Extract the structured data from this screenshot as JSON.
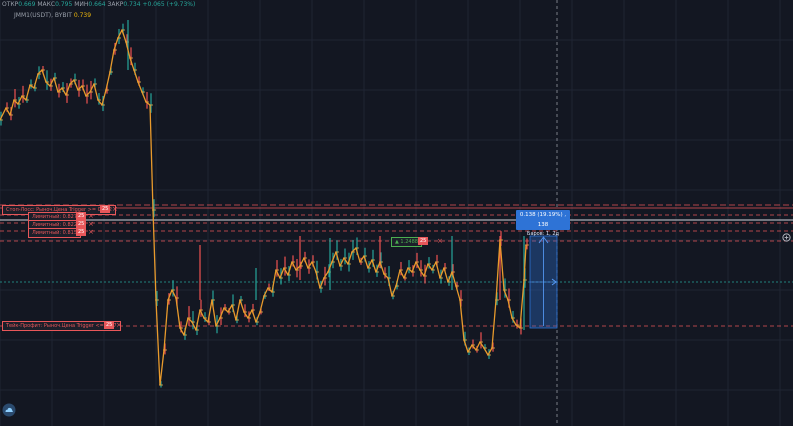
{
  "header": {
    "ohlc": [
      {
        "label": "ОТКР",
        "value": "0.669"
      },
      {
        "label": "МАКС",
        "value": "0.795"
      },
      {
        "label": "МИН",
        "value": "0.664"
      },
      {
        "label": "ЗАКР",
        "value": "0.734"
      }
    ],
    "change": "+0.065 (+9.73%)",
    "indicator_label": "JMM1(USDT), BYBIT",
    "indicator_value": "0.739"
  },
  "orders": {
    "stop_loss": {
      "label": "Стоп-Лосс: Рыноч.Цена Trigger >= 0.832",
      "count": "25",
      "close": "×"
    },
    "limit_1": {
      "label": "Лимитный: 0.827",
      "count": "25",
      "close": "×"
    },
    "limit_2": {
      "label": "Лимитный: 0.822",
      "count": "25",
      "close": "×"
    },
    "limit_3": {
      "label": "Лимитный: 0.815",
      "count": "25",
      "close": "×"
    },
    "take_profit": {
      "label": "Тейк-Профит: Рыноч.Цена Trigger <= 0.67",
      "count": "25",
      "close": "×"
    },
    "position": {
      "label": "▲ 1.2488",
      "count": "25",
      "close": "×"
    }
  },
  "measure_tooltip": {
    "line1": "0.138 (19.19%) , 138",
    "line2": "Баров: 1, 2д"
  },
  "colors": {
    "background": "#131722",
    "up": "#26a69a",
    "down": "#ef5350",
    "line": "#e89a2c",
    "order": "#e8575a",
    "measure": "#2e73d6"
  },
  "icons": {
    "logo": "cloud-logo-icon",
    "scale": "circle-plus-icon"
  }
}
